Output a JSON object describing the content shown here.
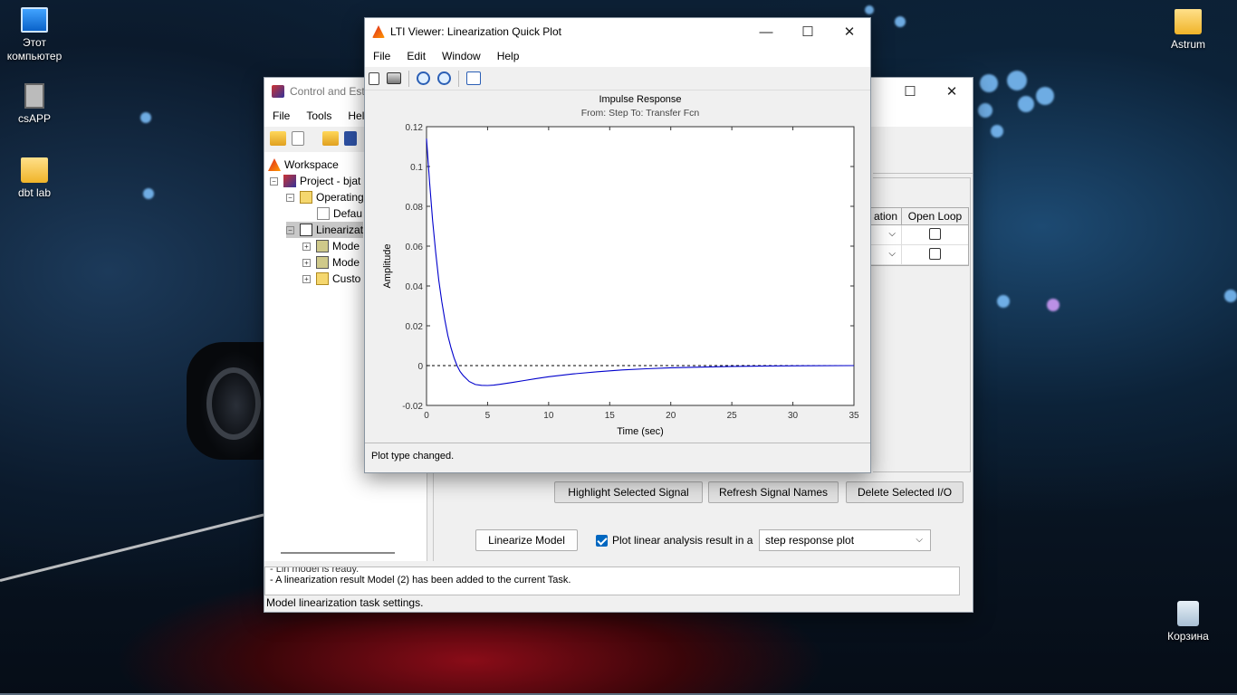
{
  "desktop": {
    "icons": [
      {
        "label": "Этот компьютер",
        "icon": "computer-icon"
      },
      {
        "label": "csAPP",
        "icon": "app-icon"
      },
      {
        "label": "dbt lab",
        "icon": "folder-icon"
      },
      {
        "label": "Astrum",
        "icon": "folder-icon"
      },
      {
        "label": "Корзина",
        "icon": "recycle-bin-icon"
      }
    ]
  },
  "back_window": {
    "title": "Control and Est",
    "menu": [
      "File",
      "Tools",
      "Help"
    ],
    "tree": [
      {
        "label": "Workspace"
      },
      {
        "label": "Project - bjat"
      },
      {
        "label": "Operating"
      },
      {
        "label": "Defau"
      },
      {
        "label": "Linearizat"
      },
      {
        "label": "Mode"
      },
      {
        "label": "Mode"
      },
      {
        "label": "Custo"
      }
    ],
    "io_table": {
      "col_left": "ation",
      "col_open_loop": "Open Loop"
    },
    "buttons": {
      "highlight": "Highlight Selected Signal",
      "refresh": "Refresh Signal Names",
      "delete": "Delete Selected I/O",
      "linearize": "Linearize Model"
    },
    "plot_checkbox_label": "Plot linear analysis result in a",
    "plot_type_selected": "step response plot",
    "log_partial": "- Lin model is ready.",
    "log_line": "- A linearization result Model (2) has been added to the current Task.",
    "status": "Model linearization task settings."
  },
  "lti_window": {
    "title": "LTI Viewer: Linearization Quick Plot",
    "menu": [
      "File",
      "Edit",
      "Window",
      "Help"
    ],
    "status": "Plot type changed."
  },
  "chart_data": {
    "type": "line",
    "title": "Impulse Response",
    "subtitle": "From: Step  To: Transfer Fcn",
    "xlabel": "Time (sec)",
    "ylabel": "Amplitude",
    "xlim": [
      0,
      35
    ],
    "ylim": [
      -0.02,
      0.12
    ],
    "xticks": [
      "0",
      "5",
      "10",
      "15",
      "20",
      "25",
      "30",
      "35"
    ],
    "yticks": [
      "-0.02",
      "0",
      "0.02",
      "0.04",
      "0.06",
      "0.08",
      "0.1",
      "0.12"
    ],
    "series": [
      {
        "color": "#0000cc",
        "x": [
          0,
          0.25,
          0.5,
          0.75,
          1,
          1.25,
          1.5,
          1.75,
          2,
          2.25,
          2.5,
          2.75,
          3,
          3.5,
          4,
          4.5,
          5,
          5.5,
          6,
          7,
          8,
          9,
          10,
          12,
          14,
          16,
          18,
          20,
          22,
          25,
          28,
          31,
          35
        ],
        "y": [
          0.114,
          0.092,
          0.073,
          0.057,
          0.043,
          0.032,
          0.023,
          0.015,
          0.009,
          0.004,
          0.0,
          -0.003,
          -0.005,
          -0.008,
          -0.0095,
          -0.0099,
          -0.01,
          -0.0098,
          -0.0094,
          -0.0085,
          -0.0075,
          -0.0065,
          -0.0056,
          -0.0042,
          -0.0031,
          -0.0022,
          -0.0016,
          -0.0011,
          -0.0008,
          -0.0004,
          -0.0002,
          -0.0001,
          0.0
        ]
      }
    ],
    "reference_line": {
      "y": 0,
      "style": "dashed",
      "color": "#000000"
    }
  }
}
